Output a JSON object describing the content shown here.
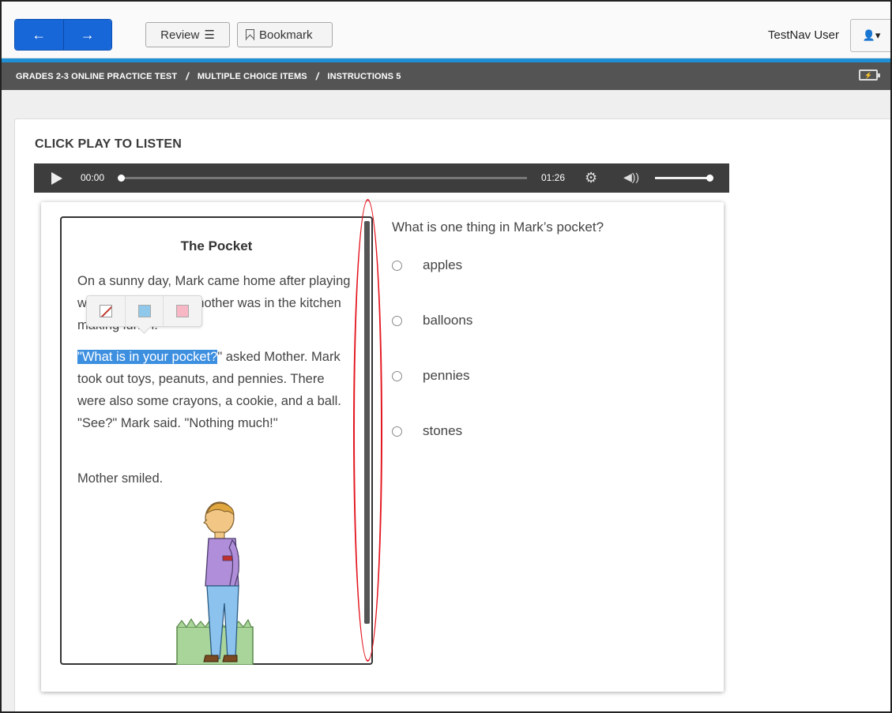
{
  "toolbar": {
    "back_icon": "arrow-left-icon",
    "forward_icon": "arrow-right-icon",
    "back_glyph": "←",
    "forward_glyph": "→",
    "review_label": "Review",
    "review_glyph": "☰",
    "bookmark_label": "Bookmark",
    "user_name": "TestNav User",
    "user_glyph": "👤▾"
  },
  "breadcrumb": {
    "items": [
      "GRADES 2-3 ONLINE PRACTICE TEST",
      "MULTIPLE CHOICE ITEMS",
      "INSTRUCTIONS 5"
    ],
    "separator": "/"
  },
  "audio": {
    "heading": "CLICK PLAY TO LISTEN",
    "current_time": "00:00",
    "total_time": "01:26",
    "progress": 0,
    "volume": 0.95,
    "gear_glyph": "⚙",
    "volume_glyph": "◀))"
  },
  "passage": {
    "title": "The Pocket",
    "paragraph1": "On a sunny day, Mark came home after playing with his friends. His mother was in the kitchen making lunch.",
    "paragraph2_highlight": "\"What is in your pocket?",
    "paragraph2_rest": "\" asked Mother. Mark took out toys, peanuts, and pennies. There were also some crayons, a cookie, and a ball. \"See?\" Mark said. \"Nothing much!\"",
    "paragraph3": "Mother smiled."
  },
  "highlighter": {
    "options": [
      "clear-highlight",
      "blue",
      "pink"
    ],
    "colors": {
      "blue": "#8fc8ea",
      "pink": "#f7b7c5"
    }
  },
  "question": {
    "prompt": "What is one thing in Mark’s pocket?",
    "choices": [
      "apples",
      "balloons",
      "pennies",
      "stones"
    ]
  },
  "colors": {
    "nav_blue": "#1867d8",
    "accent_bar": "#1f8fd6",
    "breadcrumb_bg": "#545454",
    "highlight": "#3d8fe0",
    "annotation_red": "#e3151e"
  }
}
